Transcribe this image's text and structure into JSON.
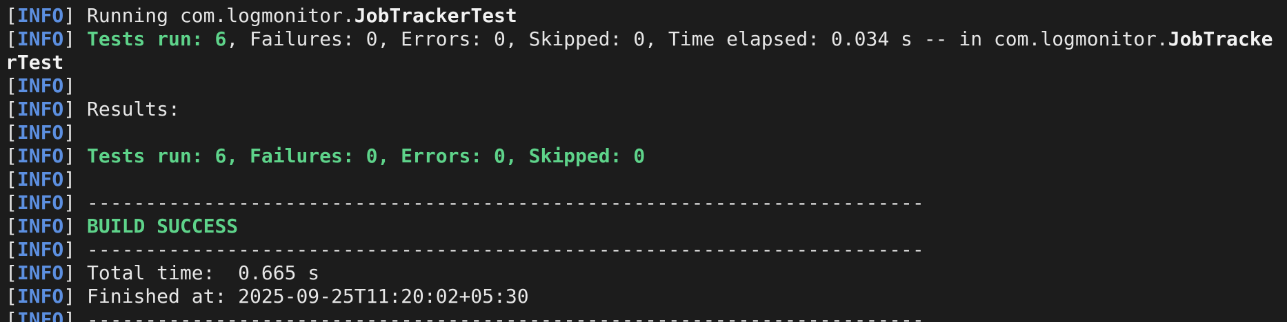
{
  "terminal": {
    "prefix_open": "[",
    "prefix_tag": "INFO",
    "prefix_close": "]",
    "running": {
      "text": "Running com.logmonitor.",
      "cls": "JobTrackerTest"
    },
    "summary1": {
      "green": "Tests run: 6",
      "rest": ", Failures: 0, Errors: 0, Skipped: 0, Time elapsed: 0.034 s -- in com.logmonitor.",
      "cls_part1": "JobTracke",
      "cls_part2": "rTest"
    },
    "results_label": "Results:",
    "summary2": "Tests run: 6, Failures: 0, Errors: 0, Skipped: 0",
    "separator": "------------------------------------------------------------------------",
    "build_status": "BUILD SUCCESS",
    "total_time": "Total time:  0.665 s",
    "finished_at": "Finished at: 2025-09-25T11:20:02+05:30"
  },
  "colors": {
    "background": "#1c1c1c",
    "info_tag": "#5c8fe0",
    "success_green": "#5ed38a",
    "text": "#e6e6e6"
  }
}
